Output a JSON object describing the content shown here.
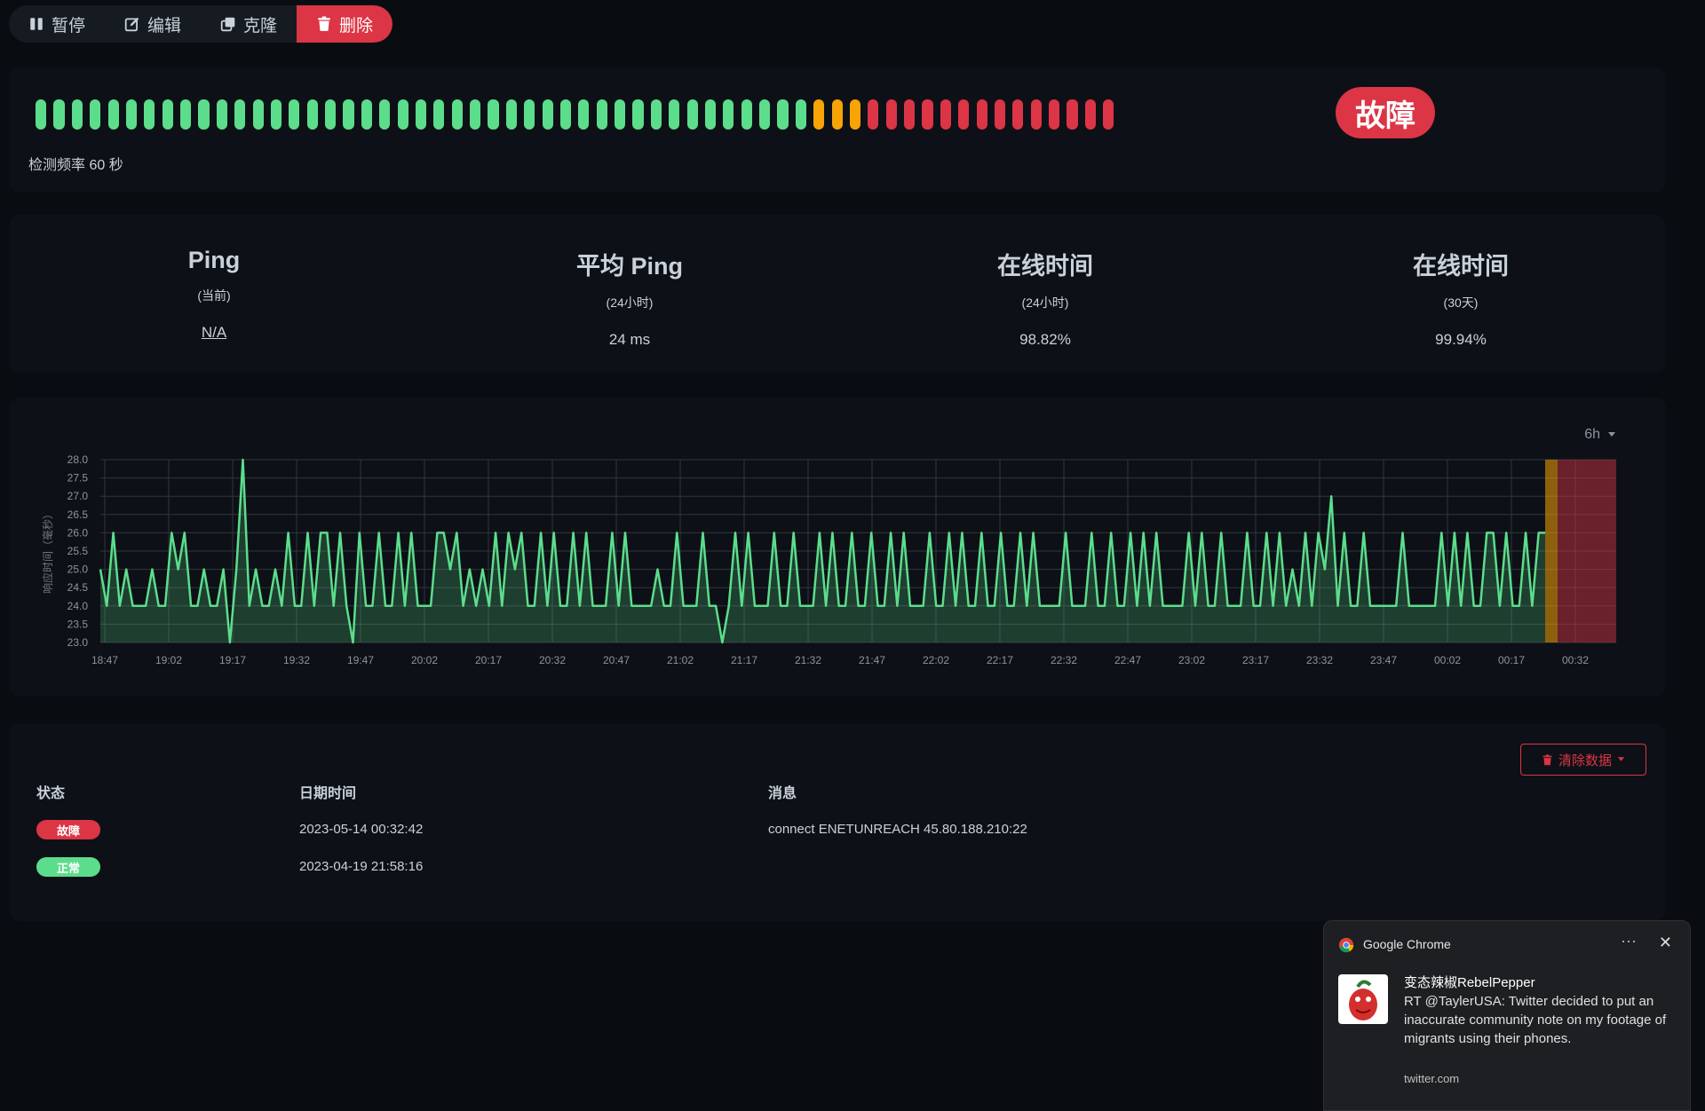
{
  "toolbar": {
    "pause_label": "暂停",
    "edit_label": "编辑",
    "clone_label": "克隆",
    "delete_label": "删除"
  },
  "heartbeat": {
    "beats": [
      "up",
      "up",
      "up",
      "up",
      "up",
      "up",
      "up",
      "up",
      "up",
      "up",
      "up",
      "up",
      "up",
      "up",
      "up",
      "up",
      "up",
      "up",
      "up",
      "up",
      "up",
      "up",
      "up",
      "up",
      "up",
      "up",
      "up",
      "up",
      "up",
      "up",
      "up",
      "up",
      "up",
      "up",
      "up",
      "up",
      "up",
      "up",
      "up",
      "up",
      "up",
      "up",
      "up",
      "pending",
      "pending",
      "pending",
      "down",
      "down",
      "down",
      "down",
      "down",
      "down",
      "down",
      "down",
      "down",
      "down",
      "down",
      "down",
      "down",
      "down"
    ],
    "frequency_text": "检测频率 60 秒",
    "status": "故障",
    "colors": {
      "up": "#5cdd8b",
      "pending": "#f8a306",
      "down": "#dc3545"
    }
  },
  "stats": [
    {
      "title": "Ping",
      "subtitle": "(当前)",
      "value": "N/A"
    },
    {
      "title": "平均 Ping",
      "subtitle": "(24小时)",
      "value": "24 ms"
    },
    {
      "title": "在线时间",
      "subtitle": "(24小时)",
      "value": "98.82%"
    },
    {
      "title": "在线时间",
      "subtitle": "(30天)",
      "value": "99.94%"
    }
  ],
  "chart": {
    "range_label": "6h"
  },
  "chart_data": {
    "type": "area",
    "ylabel": "响应时间（毫秒）",
    "ylim": [
      23.0,
      28.0
    ],
    "yticks": [
      "23.0",
      "23.5",
      "24.0",
      "24.5",
      "25.0",
      "25.5",
      "26.0",
      "26.5",
      "27.0",
      "27.5",
      "28.0"
    ],
    "xticks": [
      "18:47",
      "19:02",
      "19:17",
      "19:32",
      "19:47",
      "20:02",
      "20:17",
      "20:32",
      "20:47",
      "21:02",
      "21:17",
      "21:32",
      "21:47",
      "22:02",
      "22:17",
      "22:32",
      "22:47",
      "23:02",
      "23:17",
      "23:32",
      "23:47",
      "00:02",
      "00:17",
      "00:32"
    ],
    "series": [
      {
        "values": [
          25,
          24,
          26,
          24,
          25,
          24,
          24,
          24,
          25,
          24,
          24,
          26,
          25,
          26,
          24,
          24,
          25,
          24,
          24,
          25,
          23,
          25,
          28,
          24,
          25,
          24,
          24,
          25,
          24,
          26,
          24,
          24,
          26,
          24,
          26,
          26,
          24,
          26,
          24,
          23,
          26,
          24,
          24,
          26,
          24,
          24,
          26,
          24,
          26,
          24,
          24,
          24,
          26,
          26,
          25,
          26,
          24,
          25,
          24,
          25,
          24,
          26,
          24,
          26,
          25,
          26,
          24,
          24,
          26,
          24,
          26,
          24,
          24,
          26,
          24,
          26,
          24,
          24,
          24,
          26,
          24,
          26,
          24,
          24,
          24,
          24,
          25,
          24,
          24,
          26,
          24,
          24,
          24,
          26,
          24,
          24,
          23,
          24,
          26,
          24,
          26,
          24,
          24,
          24,
          26,
          24,
          24,
          26,
          24,
          24,
          24,
          26,
          24,
          26,
          24,
          24,
          26,
          24,
          24,
          26,
          24,
          24,
          26,
          24,
          26,
          24,
          24,
          24,
          26,
          24,
          24,
          26,
          24,
          26,
          24,
          24,
          26,
          24,
          24,
          26,
          24,
          24,
          26,
          24,
          26,
          24,
          24,
          24,
          24,
          26,
          24,
          24,
          24,
          26,
          24,
          24,
          26,
          24,
          24,
          26,
          24,
          26,
          24,
          26,
          24,
          24,
          24,
          24,
          26,
          24,
          26,
          24,
          24,
          26,
          24,
          24,
          24,
          26,
          24,
          24,
          26,
          24,
          26,
          24,
          25,
          24,
          26,
          24,
          26,
          25,
          27,
          24,
          26,
          24,
          24,
          26,
          24,
          24,
          24,
          24,
          24,
          26,
          24,
          24,
          24,
          24,
          24,
          26,
          24,
          26,
          24,
          26,
          24,
          24,
          26,
          26,
          24,
          26,
          24,
          24,
          26,
          24,
          26,
          26
        ]
      }
    ],
    "incident_start": "00:32",
    "grid": true
  },
  "events": {
    "clear_label": "清除数据",
    "headers": {
      "status": "状态",
      "datetime": "日期时间",
      "message": "消息"
    },
    "rows": [
      {
        "status": "故障",
        "status_color": "#dc3545",
        "datetime": "2023-05-14 00:32:42",
        "message": "connect ENETUNREACH 45.80.188.210:22"
      },
      {
        "status": "正常",
        "status_color": "#5cdd8b",
        "datetime": "2023-04-19 21:58:16",
        "message": ""
      }
    ]
  },
  "notification": {
    "app": "Google Chrome",
    "title": "变态辣椒RebelPepper",
    "body": "RT @TaylerUSA: Twitter decided to put an inaccurate community note on my footage of migrants using their phones.",
    "source": "twitter.com"
  }
}
